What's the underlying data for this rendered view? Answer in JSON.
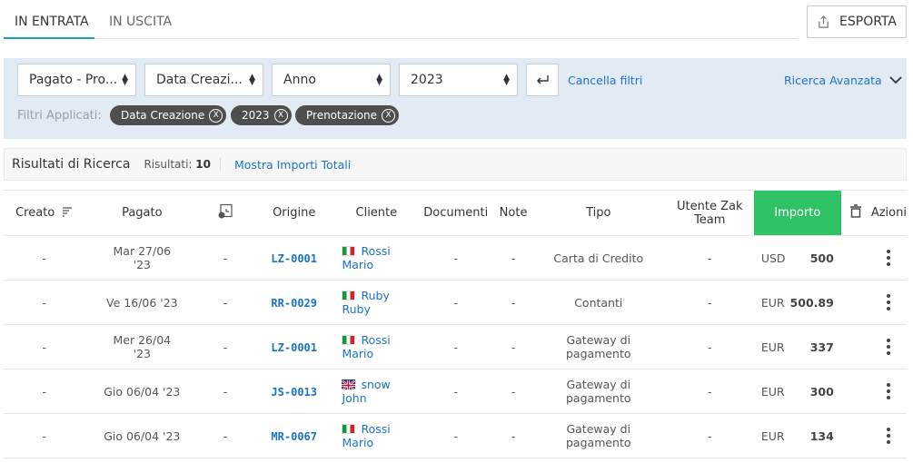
{
  "tabs": [
    {
      "label": "IN ENTRATA",
      "active": true
    },
    {
      "label": "IN USCITA",
      "active": false
    }
  ],
  "export_label": "ESPORTA",
  "filters": {
    "selects": [
      "Pagato - Pro...",
      "Data Creazi...",
      "Anno",
      "2023"
    ],
    "clear_label": "Cancella filtri",
    "advanced_label": "Ricerca Avanzata",
    "applied_label": "Filtri Applicati:",
    "chips": [
      "Data Creazione",
      "2023",
      "Prenotazione"
    ],
    "chip_remove": "X"
  },
  "results": {
    "title": "Risultati di Ricerca",
    "count_label": "Risultati:",
    "count": "10",
    "show_totals": "Mostra Importi Totali"
  },
  "columns": {
    "created": "Creato",
    "paid": "Pagato",
    "origin": "Origine",
    "client": "Cliente",
    "documents": "Documenti",
    "notes": "Note",
    "type": "Tipo",
    "user_line1": "Utente Zak",
    "user_line2": "Team",
    "amount": "Importo",
    "actions": "Azioni"
  },
  "rows": [
    {
      "created": "-",
      "paid_1": "Mar 27/06",
      "paid_2": "'23",
      "icon_col": "-",
      "origin": "LZ-0001",
      "flag": "it",
      "client_1": "Rossi",
      "client_2": "Mario",
      "documents": "-",
      "notes": "-",
      "type_1": "Carta di Credito",
      "type_2": "",
      "user": "-",
      "currency": "USD",
      "amount": "500"
    },
    {
      "created": "-",
      "paid_1": "Ve 16/06 '23",
      "paid_2": "",
      "icon_col": "-",
      "origin": "RR-0029",
      "flag": "it",
      "client_1": "Ruby Ruby",
      "client_2": "",
      "documents": "-",
      "notes": "-",
      "type_1": "Contanti",
      "type_2": "",
      "user": "-",
      "currency": "EUR",
      "amount": "500.89"
    },
    {
      "created": "-",
      "paid_1": "Mer 26/04",
      "paid_2": "'23",
      "icon_col": "-",
      "origin": "LZ-0001",
      "flag": "it",
      "client_1": "Rossi",
      "client_2": "Mario",
      "documents": "-",
      "notes": "-",
      "type_1": "Gateway di",
      "type_2": "pagamento",
      "user": "-",
      "currency": "EUR",
      "amount": "337"
    },
    {
      "created": "-",
      "paid_1": "Gio 06/04 '23",
      "paid_2": "",
      "icon_col": "-",
      "origin": "JS-0013",
      "flag": "uk",
      "client_1": "snow John",
      "client_2": "",
      "documents": "-",
      "notes": "-",
      "type_1": "Gateway di",
      "type_2": "pagamento",
      "user": "-",
      "currency": "EUR",
      "amount": "300"
    },
    {
      "created": "-",
      "paid_1": "Gio 06/04 '23",
      "paid_2": "",
      "icon_col": "-",
      "origin": "MR-0067",
      "flag": "it",
      "client_1": "Rossi",
      "client_2": "Mario",
      "documents": "-",
      "notes": "-",
      "type_1": "Gateway di",
      "type_2": "pagamento",
      "user": "-",
      "currency": "EUR",
      "amount": "134"
    }
  ],
  "colors": {
    "accent": "#1aa1a0",
    "link": "#1a73c8",
    "importo_header": "#2ec265",
    "filters_bg": "#e2eaf3"
  }
}
